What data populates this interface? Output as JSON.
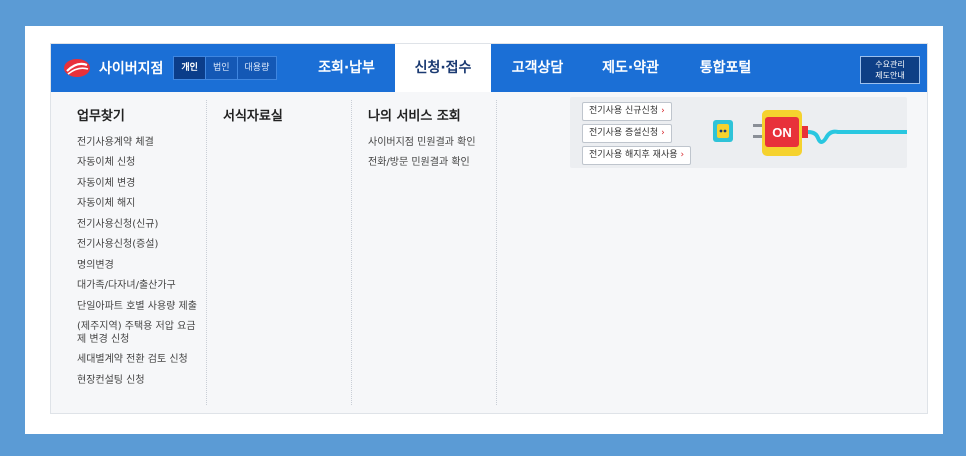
{
  "header": {
    "brand": "사이버지점",
    "segments": [
      {
        "label": "개인",
        "active": true
      },
      {
        "label": "법인",
        "active": false
      },
      {
        "label": "대용량",
        "active": false
      }
    ],
    "menu": [
      {
        "label": "조회·납부",
        "active": false
      },
      {
        "label": "신청·접수",
        "active": true
      },
      {
        "label": "고객상담",
        "active": false
      },
      {
        "label": "제도·약관",
        "active": false
      },
      {
        "label": "통합포털",
        "active": false
      }
    ],
    "demand_button": {
      "line1": "수요관리",
      "line2": "제도안내"
    }
  },
  "mega_menu": {
    "columns": [
      {
        "title": "업무찾기",
        "links": [
          "전기사용계약 체결",
          "자동이체 신청",
          "자동이체 변경",
          "자동이체 해지",
          "전기사용신청(신규)",
          "전기사용신청(증설)",
          "명의변경",
          "대가족/다자녀/출산가구",
          "단일아파트 호별 사용량 제출",
          "(제주지역) 주택용 저압 요금",
          "제 변경 신청",
          "세대별계약 전환 검토 신청",
          "현장컨설팅 신청"
        ]
      },
      {
        "title": "서식자료실",
        "links": []
      },
      {
        "title": "나의 서비스 조회",
        "links": [
          "사이버지점 민원결과 확인",
          "전화/방문 민원결과 확인"
        ]
      }
    ],
    "promo": {
      "buttons": [
        "전기사용 신규신청",
        "전기사용 증설신청",
        "전기사용 해지후 재사용"
      ],
      "arrow": "›",
      "plug_label": "ON",
      "colors": {
        "cable": "#29c7e0",
        "plug": "#e8313a",
        "socket": "#2fc3d8",
        "band": "#f5d22e"
      }
    }
  }
}
